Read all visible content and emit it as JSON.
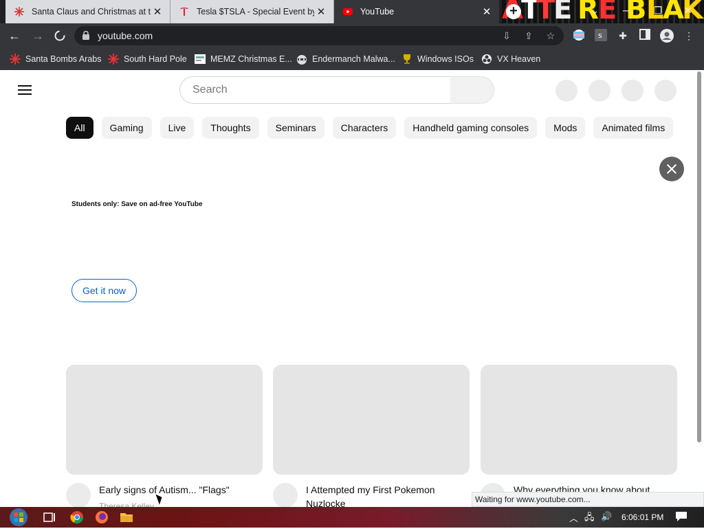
{
  "browser": {
    "tabs": [
      {
        "title": "Santa Claus and Christmas at the",
        "close": "✕",
        "active": false,
        "favicon": "snowflake-icon"
      },
      {
        "title": "Tesla $TSLA - Special Event by Elo",
        "close": "✕",
        "active": false,
        "favicon": "tesla-icon"
      },
      {
        "title": "YouTube",
        "close": "✕",
        "active": true,
        "favicon": "youtube-icon"
      }
    ],
    "new_tab": "+",
    "url": "youtube.com",
    "bookmarks": [
      {
        "label": "Santa Bombs Arabs",
        "icon": "snowflake-icon"
      },
      {
        "label": "South Hard Pole",
        "icon": "snowflake-icon"
      },
      {
        "label": "MEMZ Christmas E...",
        "icon": "page-icon"
      },
      {
        "label": "Endermanch Malwa...",
        "icon": "raccoon-icon"
      },
      {
        "label": "Windows ISOs",
        "icon": "trophy-icon"
      },
      {
        "label": "VX Heaven",
        "icon": "biohazard-icon"
      }
    ],
    "status_text": "Waiting for www.youtube.com..."
  },
  "youtube": {
    "search_placeholder": "Search",
    "chips": [
      "All",
      "Gaming",
      "Live",
      "Thoughts",
      "Seminars",
      "Characters",
      "Handheld gaming consoles",
      "Mods",
      "Animated films"
    ],
    "selected_chip": "All",
    "promo_text": "Students only: Save on ad-free YouTube",
    "promo_button": "Get it now",
    "videos": [
      {
        "title": "Early signs of Autism... \"Flags\"",
        "channel": "Theresa Kelley"
      },
      {
        "title": "I Attempted my First Pokemon Nuzlocke",
        "channel": ""
      },
      {
        "title": "Why everything you know about",
        "channel": ""
      }
    ]
  },
  "taskbar": {
    "clock": "6:06:01 PM"
  },
  "colors": {
    "chrome_dark": "#35363a",
    "tab_inactive": "#dadce0",
    "youtube_blue": "#065fd4",
    "chip_selected": "#0f0f0f",
    "placeholder_gray": "#e5e5e5"
  }
}
